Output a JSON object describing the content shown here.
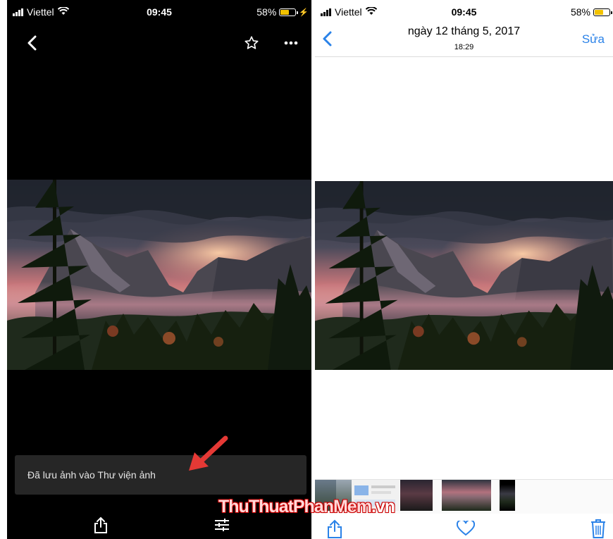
{
  "left_screen": {
    "status": {
      "carrier": "Viettel",
      "time": "09:45",
      "battery": "58%"
    },
    "toast_text": "Đã lưu ảnh vào Thư viện ảnh",
    "toolbar": {
      "icons": [
        "share-icon",
        "adjust-icon"
      ]
    },
    "header_icons": [
      "back-chevron-icon",
      "star-icon",
      "more-icon"
    ]
  },
  "right_screen": {
    "status": {
      "carrier": "Viettel",
      "time": "09:45",
      "battery": "58%"
    },
    "nav": {
      "title": "ngày 12 tháng 5, 2017",
      "subtitle": "18:29",
      "edit_label": "Sửa"
    },
    "toolbar": {
      "icons": [
        "share-icon",
        "heart-icon",
        "trash-icon"
      ]
    }
  },
  "watermark": {
    "part1": "ThuThuatPhanMem",
    "part2": ".vn"
  },
  "colors": {
    "ios_blue": "#2a82e8",
    "battery": "#f2c200",
    "arrow": "#e53935"
  }
}
